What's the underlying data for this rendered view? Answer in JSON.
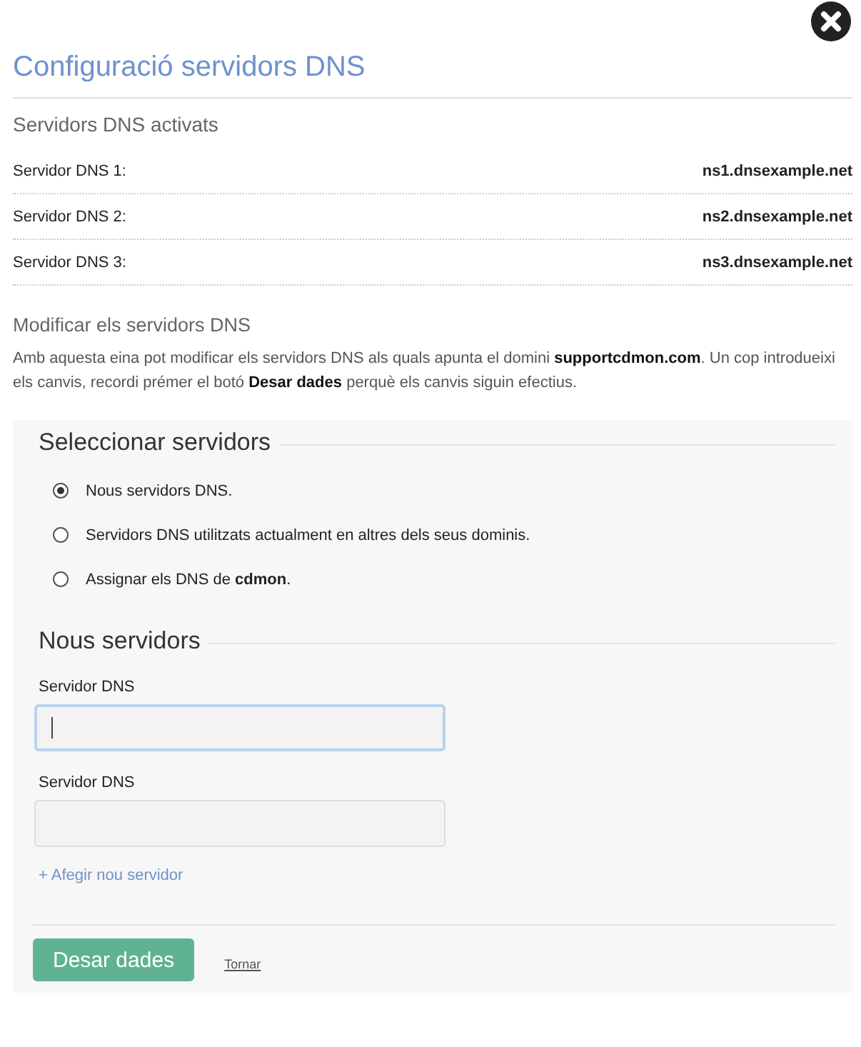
{
  "title": "Configuració servidors DNS",
  "active_section": {
    "heading": "Servidors DNS activats",
    "rows": [
      {
        "label": "Servidor DNS 1:",
        "value": "ns1.dnsexample.net"
      },
      {
        "label": "Servidor DNS 2:",
        "value": "ns2.dnsexample.net"
      },
      {
        "label": "Servidor DNS 3:",
        "value": "ns3.dnsexample.net"
      }
    ]
  },
  "modify_section": {
    "heading": "Modificar els servidors DNS",
    "description": "Amb aquesta eina pot modificar els servidors DNS als quals apunta el domini **supportcdmon.com**. Un cop introdueixi els canvis, recordi prémer el botó **Desar dades** perquè els canvis siguin efectius."
  },
  "select_servers": {
    "legend": "Seleccionar servidors",
    "options": [
      {
        "label": "Nous servidors DNS.",
        "selected": true
      },
      {
        "label": "Servidors DNS utilitzats actualment en altres dels seus dominis.",
        "selected": false
      },
      {
        "label": "Assignar els DNS de **cdmon**.",
        "selected": false
      }
    ]
  },
  "new_servers": {
    "legend": "Nous servidors",
    "fields": [
      {
        "label": "Servidor DNS",
        "focused": true
      },
      {
        "label": "Servidor DNS",
        "focused": false
      }
    ],
    "add_link": "+ Afegir nou servidor"
  },
  "buttons": {
    "save": "Desar dades",
    "back": "Tornar"
  }
}
